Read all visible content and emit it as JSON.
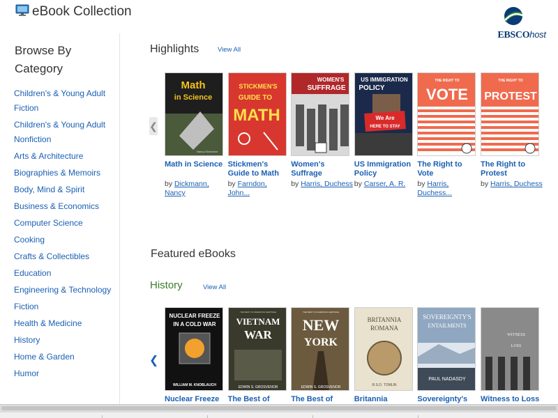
{
  "header": {
    "title": "eBook Collection",
    "app_icon": "monitor-icon",
    "logo": {
      "name": "ebsco-logo",
      "text_bold": "EBSCO",
      "text_italic": "host",
      "colors": {
        "blue": "#0c3b76",
        "green": "#2a8a3a"
      }
    }
  },
  "sidebar": {
    "heading": "Browse By Category",
    "categories": [
      "Children's & Young Adult Fiction",
      "Children's & Young Adult Nonfiction",
      "Arts & Architecture",
      "Biographies & Memoirs",
      "Body, Mind & Spirit",
      "Business & Economics",
      "Computer Science",
      "Cooking",
      "Crafts & Collectibles",
      "Education",
      "Engineering & Technology",
      "Fiction",
      "Health & Medicine",
      "History",
      "Home & Garden",
      "Humor"
    ]
  },
  "highlights": {
    "title": "Highlights",
    "view_all": "View All",
    "prev_arrow": "❮",
    "books": [
      {
        "title": "Math in Science",
        "by": "by",
        "author": "Dickmann, Nancy"
      },
      {
        "title": "Stickmen's Guide to Math",
        "by": "by",
        "author": "Farndon, John..."
      },
      {
        "title": "Women's Suffrage",
        "by": "by",
        "author": "Harris, Duchess"
      },
      {
        "title": "US Immigration Policy",
        "by": "by",
        "author": "Carser, A. R."
      },
      {
        "title": "The Right to Vote",
        "by": "by",
        "author": "Harris, Duchess..."
      },
      {
        "title": "The Right to Protest",
        "by": "by",
        "author": "Harris, Duchess"
      }
    ],
    "covers": [
      {
        "texts": [
          "Math",
          "in Science",
          "Nancy Dickmann"
        ],
        "bg": "#1e1e1e"
      },
      {
        "texts": [
          "STICKMEN'S",
          "GUIDE TO",
          "MATH"
        ],
        "bg": "#d8372f"
      },
      {
        "texts": [
          "WOMEN'S",
          "SUFFRAGE"
        ],
        "bg": "#b0282a"
      },
      {
        "texts": [
          "US IMMIGRATION",
          "POLICY",
          "We Are",
          "HERE TO STAY"
        ],
        "bg": "#1b2a4a"
      },
      {
        "texts": [
          "THE RIGHT TO",
          "VOTE"
        ],
        "bg": "#f06a4e"
      },
      {
        "texts": [
          "THE RIGHT TO",
          "PROTEST"
        ],
        "bg": "#f06a4e"
      }
    ]
  },
  "featured": {
    "title": "Featured eBooks",
    "history": {
      "title": "History",
      "view_all": "View All",
      "prev_arrow": "❮",
      "books": [
        {
          "title": "Nuclear Freeze"
        },
        {
          "title": "The Best of"
        },
        {
          "title": "The Best of"
        },
        {
          "title": "Britannia"
        },
        {
          "title": "Sovereignty's"
        },
        {
          "title": "Witness to Loss"
        }
      ],
      "covers": [
        {
          "texts": [
            "NUCLEAR FREEZE",
            "IN A COLD WAR",
            "WILLIAM M. KNOBLAUCH"
          ],
          "bg": "#111111"
        },
        {
          "texts": [
            "THE BEST OF AMERICAN HERITAGE",
            "VIETNAM",
            "WAR",
            "EDWIN S. GROSVENOR"
          ],
          "bg": "#3a3a2c"
        },
        {
          "texts": [
            "THE BEST OF AMERICAN HERITAGE",
            "NEW",
            "YORK",
            "EDWIN S. GROSVENOR"
          ],
          "bg": "#6b5a3e"
        },
        {
          "texts": [
            "BRITANNIA",
            "ROMANA",
            "R.S.O. TOMLIN"
          ],
          "bg": "#e9e2cf"
        },
        {
          "texts": [
            "SOVEREIGNTY'S",
            "ENTAILMENTS",
            "PAUL NADASDY"
          ],
          "bg": "#8fa7c0"
        },
        {
          "texts": [
            "WITNESS",
            "LOSS"
          ],
          "bg": "#7a7a7a"
        }
      ]
    }
  }
}
